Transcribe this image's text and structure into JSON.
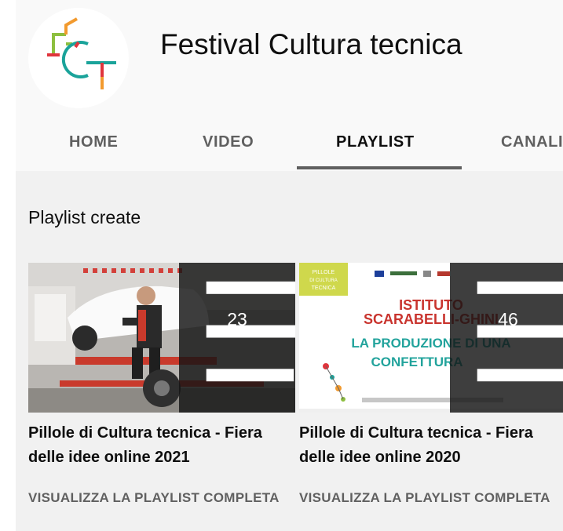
{
  "channel": {
    "name": "Festival Cultura tecnica",
    "logo_text": "FCT"
  },
  "tabs": [
    {
      "label": "HOME",
      "active": false
    },
    {
      "label": "VIDEO",
      "active": false
    },
    {
      "label": "PLAYLIST",
      "active": true
    },
    {
      "label": "CANALI",
      "active": false
    }
  ],
  "section": {
    "title": "Playlist create"
  },
  "playlists": [
    {
      "title": "Pillole di Cultura tecnica - Fiera delle idee online 2021",
      "video_count": "23",
      "link_label": "VISUALIZZA LA PLAYLIST COMPLETA"
    },
    {
      "title": "Pillole di Cultura tecnica - Fiera delle idee online 2020",
      "video_count": "46",
      "link_label": "VISUALIZZA LA PLAYLIST COMPLETA",
      "thumbnail_text": {
        "badge": "PILLOLE DI CULTURA TECNICA",
        "line1": "ISTITUTO",
        "line2": "SCARABELLI-GHINI",
        "line3": "LA PRODUZIONE DI UNA",
        "line4": "CONFETTURA"
      }
    }
  ],
  "colors": {
    "header_bg": "#f9f9f9",
    "content_bg": "#f1f1f1",
    "secondary_text": "#606060",
    "logo_green": "#8dbf3f",
    "logo_red": "#e0343c",
    "logo_orange": "#f29a2e",
    "logo_teal": "#1aa39a"
  }
}
